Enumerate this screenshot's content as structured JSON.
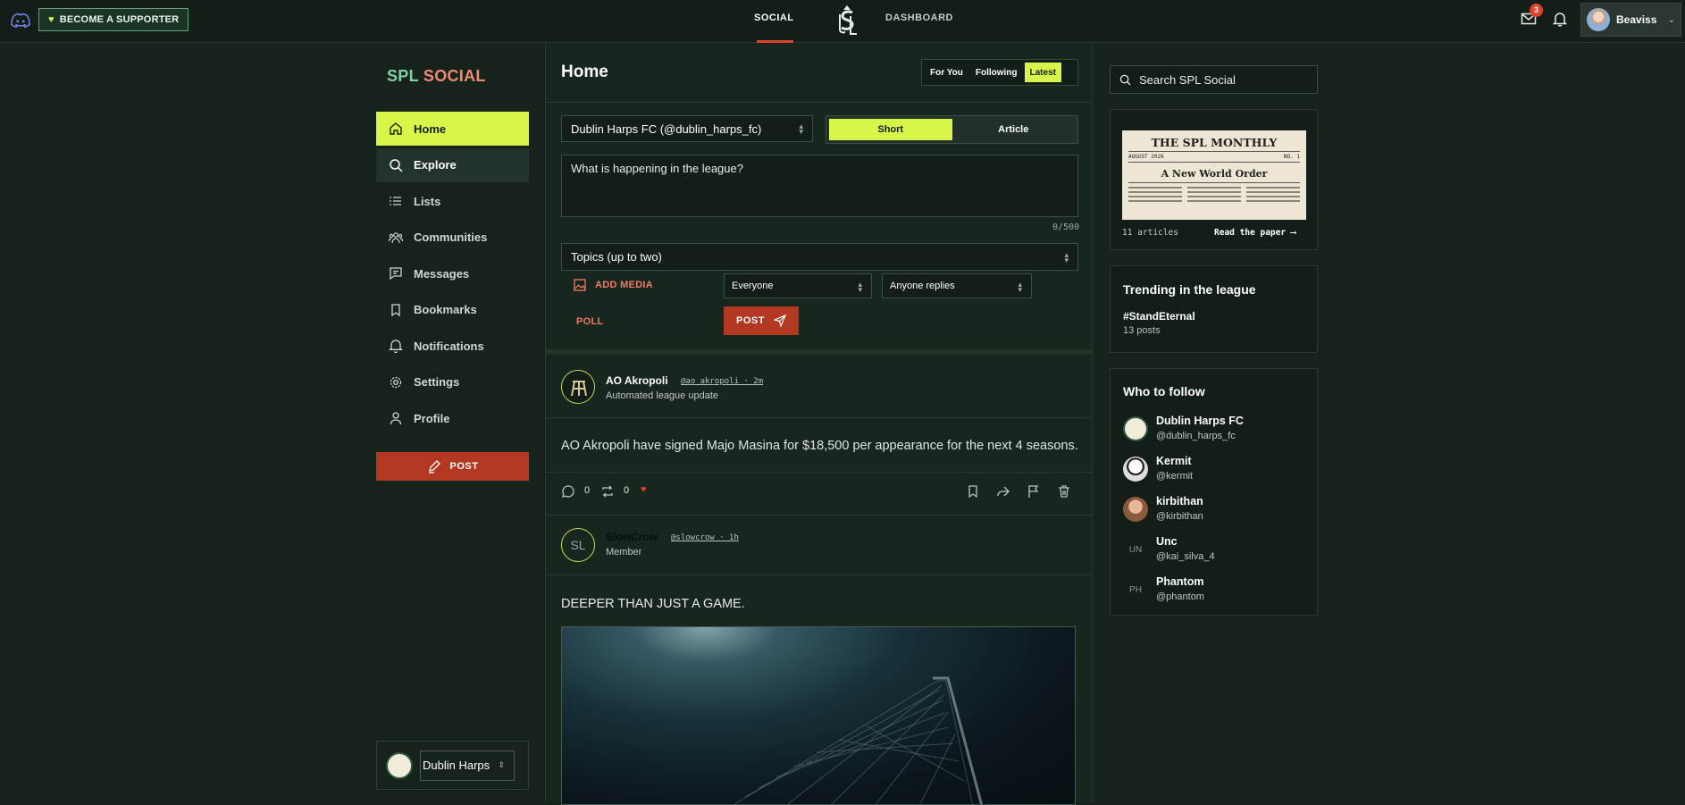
{
  "topbar": {
    "supporter_label": "BECOME A SUPPORTER",
    "nav_social": "SOCIAL",
    "nav_dashboard": "DASHBOARD",
    "mail_count": "3",
    "username": "Beaviss"
  },
  "sidebar": {
    "brand_a": "SPL",
    "brand_b": "SOCIAL",
    "items": [
      {
        "label": "Home",
        "icon": "home-icon"
      },
      {
        "label": "Explore",
        "icon": "search-icon"
      },
      {
        "label": "Lists",
        "icon": "list-icon"
      },
      {
        "label": "Communities",
        "icon": "people-icon"
      },
      {
        "label": "Messages",
        "icon": "message-icon"
      },
      {
        "label": "Bookmarks",
        "icon": "bookmark-icon"
      },
      {
        "label": "Notifications",
        "icon": "bell-icon"
      },
      {
        "label": "Settings",
        "icon": "gear-icon"
      },
      {
        "label": "Profile",
        "icon": "user-icon"
      }
    ],
    "post_label": "POST",
    "team_select": "Dublin Harps"
  },
  "main": {
    "title": "Home",
    "feed_tabs": [
      "For You",
      "Following",
      "Latest"
    ],
    "active_tab": "Latest",
    "composer": {
      "account": "Dublin Harps FC (@dublin_harps_fc)",
      "mode_short": "Short",
      "mode_article": "Article",
      "placeholder": "What is happening in the league?",
      "counter": "0/500",
      "topics_placeholder": "Topics (up to two)",
      "add_media": "ADD MEDIA",
      "poll": "POLL",
      "visibility": "Everyone",
      "replies": "Anyone replies",
      "post": "POST"
    },
    "posts": [
      {
        "author": "AO Akropoli",
        "handle": "@ao_akropoli · 2m",
        "subtitle": "Automated league update",
        "text": "AO Akropoli have signed Majo Masina for $18,500 per appearance for the next 4 seasons.",
        "comments": "0",
        "reposts": "0"
      },
      {
        "author": "SlowCrow",
        "initials": "SL",
        "handle": "@slowcrow · 1h",
        "subtitle": "Member",
        "text": "DEEPER THAN JUST A GAME."
      }
    ]
  },
  "right": {
    "search_placeholder": "Search SPL Social",
    "paper": {
      "title": "THE SPL MONTHLY",
      "date": "AUGUST 2026",
      "issue": "NO. 1",
      "headline": "A New World Order",
      "articles": "11 articles",
      "read": "Read the paper ⟶"
    },
    "trending": {
      "title": "Trending in the league",
      "tag": "#StandEternal",
      "count": "13 posts"
    },
    "follow": {
      "title": "Who to follow",
      "items": [
        {
          "name": "Dublin Harps FC",
          "handle": "@dublin_harps_fc",
          "initials": ""
        },
        {
          "name": "Kermit",
          "handle": "@kermit",
          "initials": ""
        },
        {
          "name": "kirbithan",
          "handle": "@kirbithan",
          "initials": ""
        },
        {
          "name": "Unc",
          "handle": "@kai_silva_4",
          "initials": "UN"
        },
        {
          "name": "Phantom",
          "handle": "@phantom",
          "initials": "PH"
        }
      ]
    }
  },
  "colors": {
    "accent": "#d8f54a",
    "brand_red": "#b23822",
    "background": "#15231b"
  }
}
